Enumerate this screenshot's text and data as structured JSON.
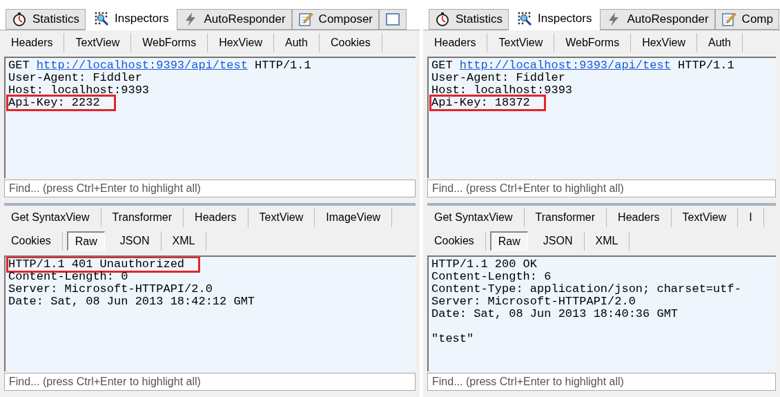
{
  "panels": [
    {
      "top_tabs": [
        {
          "label": "Statistics",
          "kind": "stopwatch",
          "selected": false
        },
        {
          "label": "Inspectors",
          "kind": "inspect",
          "selected": true
        },
        {
          "label": "AutoResponder",
          "kind": "bolt",
          "selected": false
        },
        {
          "label": "Composer",
          "kind": "compose",
          "selected": false
        },
        {
          "kind": "blank",
          "selected": false
        }
      ],
      "request": {
        "tabs": [
          {
            "label": "Headers",
            "selected": false
          },
          {
            "label": "TextView",
            "selected": false
          },
          {
            "label": "WebForms",
            "selected": false
          },
          {
            "label": "HexView",
            "selected": false
          },
          {
            "label": "Auth",
            "selected": false
          },
          {
            "label": "Cookies",
            "selected": false
          }
        ],
        "lines": [
          {
            "kind": "request_line",
            "method": "GET",
            "url": "http://localhost:9393/api/test",
            "version": "HTTP/1.1",
            "highlighted": false
          },
          {
            "kind": "text",
            "text": "User-Agent: Fiddler",
            "highlighted": false
          },
          {
            "kind": "text",
            "text": "Host: localhost:9393",
            "highlighted": false
          },
          {
            "kind": "text",
            "text": "Api-Key: 2232",
            "highlighted": true
          }
        ],
        "find_placeholder": "Find... (press Ctrl+Enter to highlight all)"
      },
      "response": {
        "tab_rows": [
          [
            {
              "label": "Get SyntaxView",
              "selected": false
            },
            {
              "label": "Transformer",
              "selected": false
            },
            {
              "label": "Headers",
              "selected": false
            },
            {
              "label": "TextView",
              "selected": false
            },
            {
              "label": "ImageView",
              "selected": false
            }
          ],
          [
            {
              "label": "Cookies",
              "selected": false
            },
            {
              "label": "Raw",
              "selected": true
            },
            {
              "label": "JSON",
              "selected": false
            },
            {
              "label": "XML",
              "selected": false
            }
          ]
        ],
        "lines": [
          {
            "kind": "text",
            "text": "HTTP/1.1 401 Unauthorized",
            "highlighted": true
          },
          {
            "kind": "text",
            "text": "Content-Length: 0",
            "highlighted": false
          },
          {
            "kind": "text",
            "text": "Server: Microsoft-HTTPAPI/2.0",
            "highlighted": false
          },
          {
            "kind": "text",
            "text": "Date: Sat, 08 Jun 2013 18:42:12 GMT",
            "highlighted": false
          }
        ],
        "find_placeholder": "Find... (press Ctrl+Enter to highlight all)"
      }
    },
    {
      "top_tabs": [
        {
          "label": "Statistics",
          "kind": "stopwatch",
          "selected": false
        },
        {
          "label": "Inspectors",
          "kind": "inspect",
          "selected": true
        },
        {
          "label": "AutoResponder",
          "kind": "bolt",
          "selected": false
        },
        {
          "label": "Comp",
          "kind": "compose",
          "selected": false
        }
      ],
      "request": {
        "tabs": [
          {
            "label": "Headers",
            "selected": false
          },
          {
            "label": "TextView",
            "selected": false
          },
          {
            "label": "WebForms",
            "selected": false
          },
          {
            "label": "HexView",
            "selected": false
          },
          {
            "label": "Auth",
            "selected": false
          }
        ],
        "lines": [
          {
            "kind": "request_line",
            "method": "GET",
            "url": "http://localhost:9393/api/test",
            "version": "HTTP/1.1",
            "highlighted": false
          },
          {
            "kind": "text",
            "text": "User-Agent: Fiddler",
            "highlighted": false
          },
          {
            "kind": "text",
            "text": "Host: localhost:9393",
            "highlighted": false
          },
          {
            "kind": "text",
            "text": "Api-Key: 18372",
            "highlighted": true
          }
        ],
        "find_placeholder": "Find... (press Ctrl+Enter to highlight all)"
      },
      "response": {
        "tab_rows": [
          [
            {
              "label": "Get SyntaxView",
              "selected": false
            },
            {
              "label": "Transformer",
              "selected": false
            },
            {
              "label": "Headers",
              "selected": false
            },
            {
              "label": "TextView",
              "selected": false
            },
            {
              "label": "I",
              "selected": false
            }
          ],
          [
            {
              "label": "Cookies",
              "selected": false
            },
            {
              "label": "Raw",
              "selected": true
            },
            {
              "label": "JSON",
              "selected": false
            },
            {
              "label": "XML",
              "selected": false
            }
          ]
        ],
        "lines": [
          {
            "kind": "text",
            "text": "HTTP/1.1 200 OK",
            "highlighted": false
          },
          {
            "kind": "text",
            "text": "Content-Length: 6",
            "highlighted": false
          },
          {
            "kind": "text",
            "text": "Content-Type: application/json; charset=utf-",
            "highlighted": false
          },
          {
            "kind": "text",
            "text": "Server: Microsoft-HTTPAPI/2.0",
            "highlighted": false
          },
          {
            "kind": "text",
            "text": "Date: Sat, 08 Jun 2013 18:40:36 GMT",
            "highlighted": false
          },
          {
            "kind": "blank",
            "highlighted": false
          },
          {
            "kind": "text",
            "text": "\"test\"",
            "highlighted": false
          }
        ],
        "find_placeholder": "Find... (press Ctrl+Enter to highlight all)"
      }
    }
  ]
}
